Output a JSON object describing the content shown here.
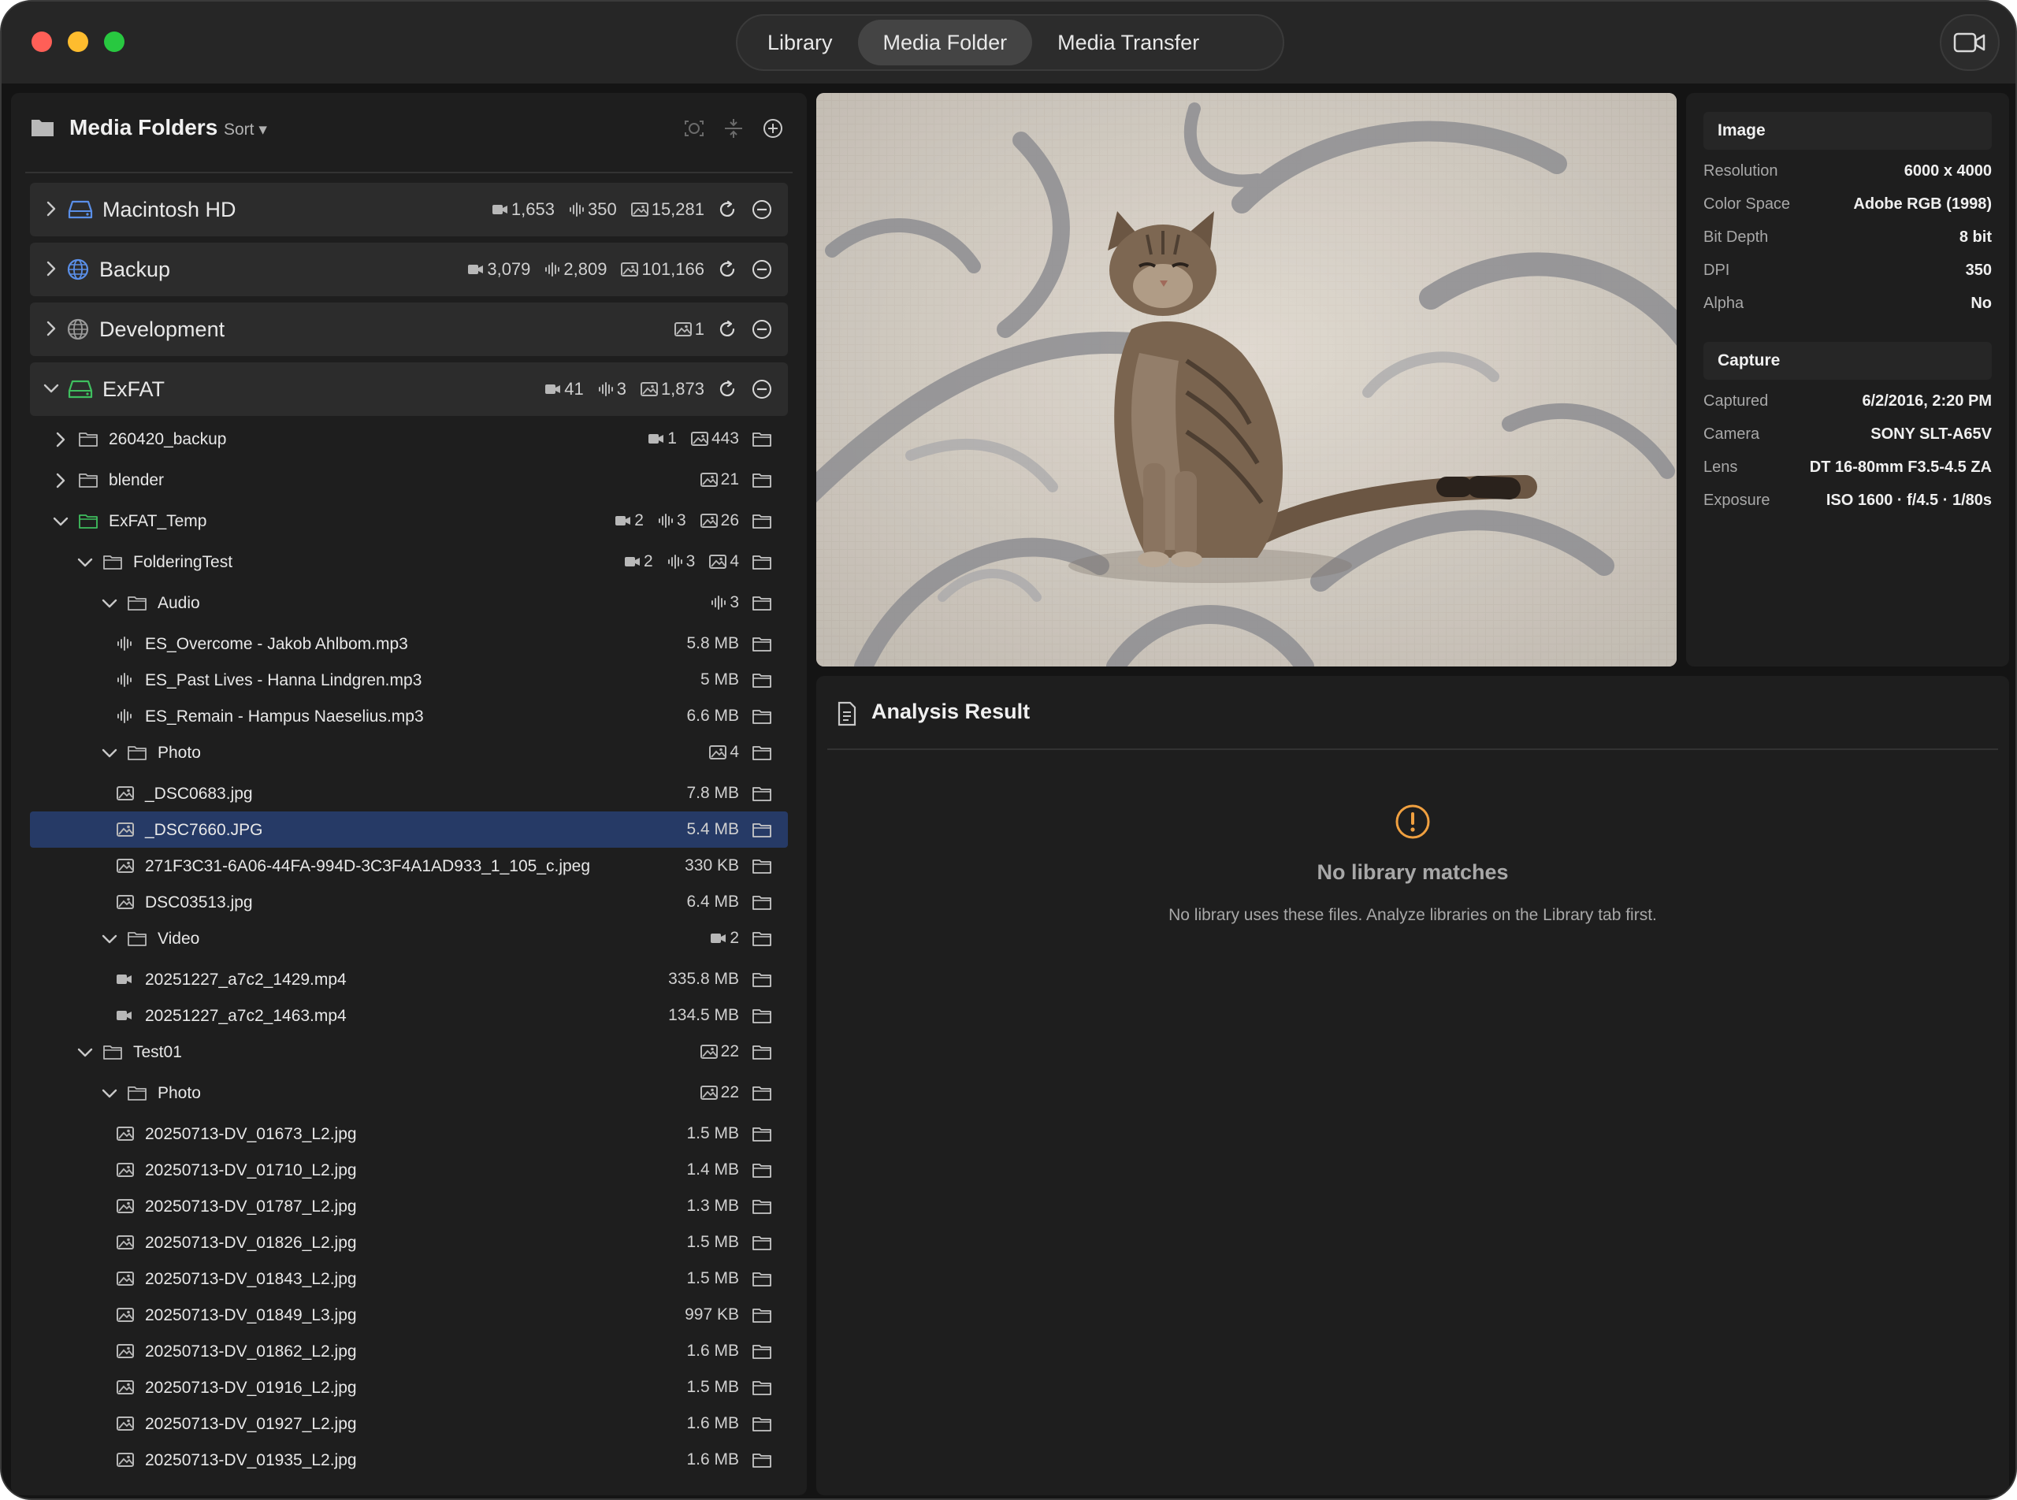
{
  "tabs": {
    "library": "Library",
    "media_folder": "Media Folder",
    "media_transfer": "Media Transfer",
    "active": "Media Folder"
  },
  "left_panel": {
    "title": "Media Folders",
    "sort_label": "Sort ▾",
    "icons": [
      "refresh-scan-icon",
      "collapse-icon",
      "add-icon"
    ]
  },
  "volumes": [
    {
      "name": "Macintosh HD",
      "icon": "drive-icon",
      "color": "#5a8fe8",
      "expanded": false,
      "video": "1,653",
      "audio": "350",
      "photo": "15,281"
    },
    {
      "name": "Backup",
      "icon": "globe-icon",
      "color": "#5a8fe8",
      "expanded": false,
      "video": "3,079",
      "audio": "2,809",
      "photo": "101,166"
    },
    {
      "name": "Development",
      "icon": "globe-icon",
      "color": "#9a9a9a",
      "expanded": false,
      "video": "",
      "audio": "",
      "photo": "1"
    },
    {
      "name": "ExFAT",
      "icon": "drive-icon",
      "color": "#3fbf5f",
      "expanded": true,
      "video": "41",
      "audio": "3",
      "photo": "1,873"
    }
  ],
  "tree_items": [
    {
      "label": "260420_backup",
      "type": "folder",
      "depth": 0,
      "chevron": "right",
      "video": "1",
      "audio": "",
      "photo": "443",
      "size": ""
    },
    {
      "label": "blender",
      "type": "folder",
      "depth": 0,
      "chevron": "right",
      "video": "",
      "audio": "",
      "photo": "21",
      "size": ""
    },
    {
      "label": "ExFAT_Temp",
      "type": "folder-green",
      "depth": 0,
      "chevron": "down",
      "video": "2",
      "audio": "3",
      "photo": "26",
      "size": ""
    },
    {
      "label": "FolderingTest",
      "type": "folder",
      "depth": 1,
      "chevron": "down",
      "video": "2",
      "audio": "3",
      "photo": "4",
      "size": ""
    },
    {
      "label": "Audio",
      "type": "folder",
      "depth": 2,
      "chevron": "down",
      "video": "",
      "audio": "3",
      "photo": "",
      "size": ""
    },
    {
      "label": "ES_Overcome - Jakob Ahlbom.mp3",
      "type": "audio",
      "depth": 3,
      "chevron": "",
      "size": "5.8 MB"
    },
    {
      "label": "ES_Past Lives - Hanna Lindgren.mp3",
      "type": "audio",
      "depth": 3,
      "chevron": "",
      "size": "5 MB"
    },
    {
      "label": "ES_Remain - Hampus Naeselius.mp3",
      "type": "audio",
      "depth": 3,
      "chevron": "",
      "size": "6.6 MB"
    },
    {
      "label": "Photo",
      "type": "folder",
      "depth": 2,
      "chevron": "down",
      "video": "",
      "audio": "",
      "photo": "4",
      "size": ""
    },
    {
      "label": "_DSC0683.jpg",
      "type": "photo",
      "depth": 3,
      "chevron": "",
      "size": "7.8 MB"
    },
    {
      "label": "_DSC7660.JPG",
      "type": "photo",
      "depth": 3,
      "chevron": "",
      "size": "5.4 MB",
      "selected": true
    },
    {
      "label": "271F3C31-6A06-44FA-994D-3C3F4A1AD933_1_105_c.jpeg",
      "type": "photo",
      "depth": 3,
      "chevron": "",
      "size": "330 KB"
    },
    {
      "label": "DSC03513.jpg",
      "type": "photo",
      "depth": 3,
      "chevron": "",
      "size": "6.4 MB"
    },
    {
      "label": "Video",
      "type": "folder",
      "depth": 2,
      "chevron": "down",
      "video": "2",
      "audio": "",
      "photo": "",
      "size": ""
    },
    {
      "label": "20251227_a7c2_1429.mp4",
      "type": "video",
      "depth": 3,
      "chevron": "",
      "size": "335.8 MB"
    },
    {
      "label": "20251227_a7c2_1463.mp4",
      "type": "video",
      "depth": 3,
      "chevron": "",
      "size": "134.5 MB"
    },
    {
      "label": "Test01",
      "type": "folder",
      "depth": 1,
      "chevron": "down",
      "video": "",
      "audio": "",
      "photo": "22",
      "size": ""
    },
    {
      "label": "Photo",
      "type": "folder",
      "depth": 2,
      "chevron": "down",
      "video": "",
      "audio": "",
      "photo": "22",
      "size": ""
    },
    {
      "label": "20250713-DV_01673_L2.jpg",
      "type": "photo",
      "depth": 3,
      "chevron": "",
      "size": "1.5 MB"
    },
    {
      "label": "20250713-DV_01710_L2.jpg",
      "type": "photo",
      "depth": 3,
      "chevron": "",
      "size": "1.4 MB"
    },
    {
      "label": "20250713-DV_01787_L2.jpg",
      "type": "photo",
      "depth": 3,
      "chevron": "",
      "size": "1.3 MB"
    },
    {
      "label": "20250713-DV_01826_L2.jpg",
      "type": "photo",
      "depth": 3,
      "chevron": "",
      "size": "1.5 MB"
    },
    {
      "label": "20250713-DV_01843_L2.jpg",
      "type": "photo",
      "depth": 3,
      "chevron": "",
      "size": "1.5 MB"
    },
    {
      "label": "20250713-DV_01849_L3.jpg",
      "type": "photo",
      "depth": 3,
      "chevron": "",
      "size": "997 KB"
    },
    {
      "label": "20250713-DV_01862_L2.jpg",
      "type": "photo",
      "depth": 3,
      "chevron": "",
      "size": "1.6 MB"
    },
    {
      "label": "20250713-DV_01916_L2.jpg",
      "type": "photo",
      "depth": 3,
      "chevron": "",
      "size": "1.5 MB"
    },
    {
      "label": "20250713-DV_01927_L2.jpg",
      "type": "photo",
      "depth": 3,
      "chevron": "",
      "size": "1.6 MB"
    },
    {
      "label": "20250713-DV_01935_L2.jpg",
      "type": "photo",
      "depth": 3,
      "chevron": "",
      "size": "1.6 MB"
    }
  ],
  "image_info": {
    "section_title": "Image",
    "rows": [
      {
        "k": "Resolution",
        "v": "6000 x 4000"
      },
      {
        "k": "Color Space",
        "v": "Adobe RGB (1998)"
      },
      {
        "k": "Bit Depth",
        "v": "8 bit"
      },
      {
        "k": "DPI",
        "v": "350"
      },
      {
        "k": "Alpha",
        "v": "No"
      }
    ]
  },
  "capture_info": {
    "section_title": "Capture",
    "rows": [
      {
        "k": "Captured",
        "v": "6/2/2016, 2:20 PM"
      },
      {
        "k": "Camera",
        "v": "SONY SLT-A65V"
      },
      {
        "k": "Lens",
        "v": "DT 16-80mm F3.5-4.5 ZA"
      },
      {
        "k": "Exposure",
        "v": "ISO 1600 · f/4.5 · 1/80s"
      }
    ]
  },
  "analysis": {
    "title": "Analysis Result",
    "empty_title": "No library matches",
    "empty_subtitle": "No library uses these files. Analyze libraries on the Library tab first.",
    "warning_color": "#f0a040"
  }
}
